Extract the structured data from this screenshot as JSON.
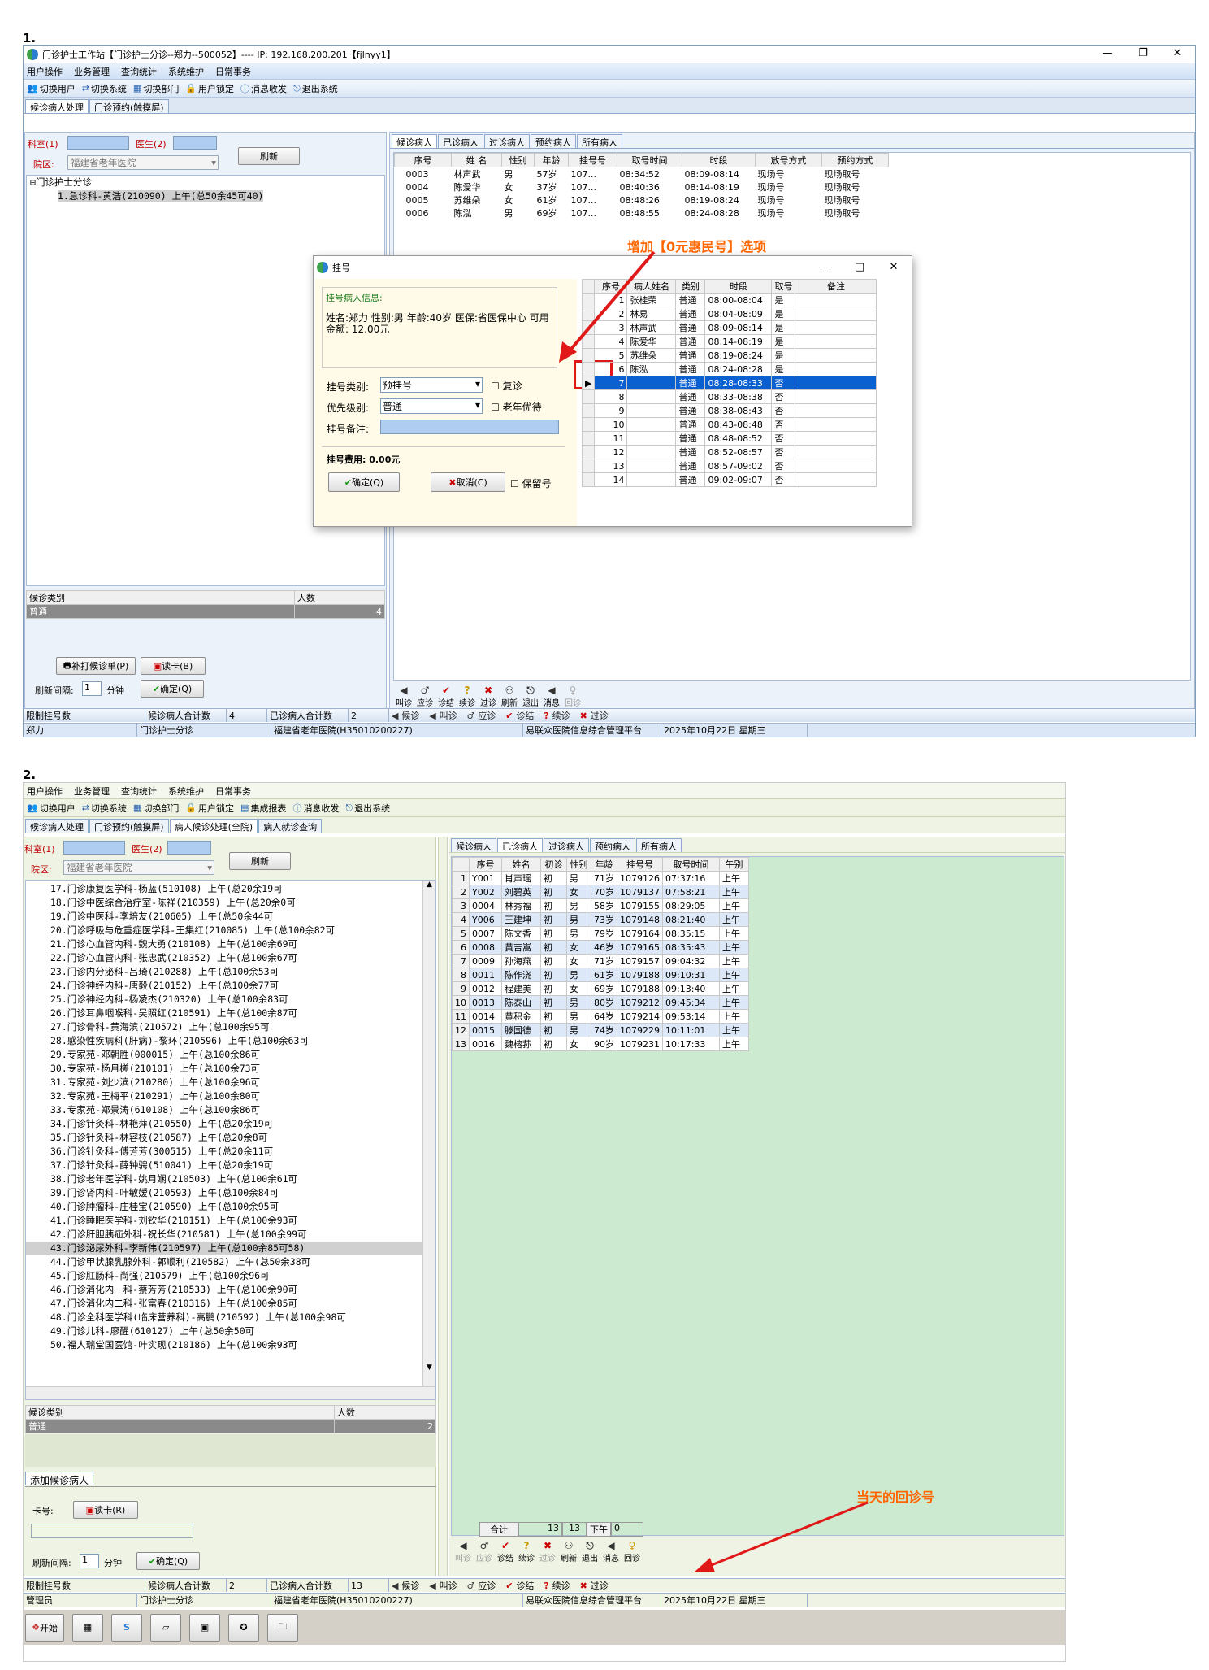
{
  "s1": {
    "num": "1.",
    "title": "门诊护士工作站【门诊护士分诊--郑力--500052】---- IP: 192.168.200.201【fjlnyy1】",
    "win_min": "—",
    "win_max": "❐",
    "win_close": "✕",
    "menu": [
      "用户操作",
      "业务管理",
      "查询统计",
      "系统维护",
      "日常事务"
    ],
    "toolbar": [
      "切换用户",
      "切换系统",
      "切换部门",
      "用户锁定",
      "消息收发",
      "退出系统"
    ],
    "tabs": [
      "候诊病人处理",
      "门诊预约(触摸屏)"
    ],
    "dept_label": "科室(1)",
    "doctor_label": "医生(2)",
    "campus_label": "院区:",
    "campus_value": "福建省老年医院",
    "refresh": "刷新",
    "tree_root": "门诊护士分诊",
    "tree_child": "1.急诊科-黄浩(210090)  上午(总50余45可40)",
    "wait_type_hdr": "候诊类别",
    "count_hdr": "人数",
    "wait_row": {
      "type": "普通",
      "count": "4"
    },
    "reprint": "补打候诊单(P)",
    "readcard": "读卡(B)",
    "interval_label": "刷新间隔:",
    "interval_val": "1",
    "interval_unit": "分钟",
    "confirm": "确定(Q)",
    "rtabs": [
      "候诊病人",
      "已诊病人",
      "过诊病人",
      "预约病人",
      "所有病人"
    ],
    "cols": [
      "序号",
      "姓 名",
      "性别",
      "年龄",
      "挂号号",
      "取号时间",
      "时段",
      "放号方式",
      "预约方式"
    ],
    "rows": [
      [
        "0003",
        "林声武",
        "男",
        "57岁",
        "107...",
        "08:34:52",
        "08:09-08:14",
        "现场号",
        "现场取号"
      ],
      [
        "0004",
        "陈爱华",
        "女",
        "37岁",
        "107...",
        "08:40:36",
        "08:14-08:19",
        "现场号",
        "现场取号"
      ],
      [
        "0005",
        "苏维朵",
        "女",
        "61岁",
        "107...",
        "08:48:26",
        "08:19-08:24",
        "现场号",
        "现场取号"
      ],
      [
        "0006",
        "陈泓",
        "男",
        "69岁",
        "107...",
        "08:48:55",
        "08:24-08:28",
        "现场号",
        "现场取号"
      ]
    ],
    "icons": [
      "叫诊",
      "应诊",
      "诊结",
      "续诊",
      "过诊",
      "刷新",
      "退出",
      "消息",
      "回诊"
    ],
    "status_icons": [
      "候诊",
      "叫诊",
      "应诊",
      "诊结",
      "续诊",
      "过诊"
    ],
    "status": [
      "限制挂号数",
      "候诊病人合计数",
      "4",
      "已诊病人合计数",
      "2"
    ],
    "footer": [
      "郑力",
      "门诊护士分诊",
      "福建省老年医院(H35010200227)",
      "易联众医院信息综合管理平台",
      "2025年10月22日 星期三"
    ],
    "annotation": "增加【0元惠民号】选项",
    "dialog": {
      "title": "挂号",
      "info_hdr": "挂号病人信息:",
      "info": "姓名:郑力 性别:男 年龄:40岁 医保:省医保中心 可用金额: 12.00元",
      "type_label": "挂号类别:",
      "type_val": "预挂号",
      "revisit": "复诊",
      "priority_label": "优先级别:",
      "priority_val": "普通",
      "elder": "老年优待",
      "remark_label": "挂号备注:",
      "fee": "挂号费用: 0.00元",
      "ok": "确定(Q)",
      "cancel": "取消(C)",
      "keep": "保留号",
      "cols": [
        "序号",
        "病人姓名",
        "类别",
        "时段",
        "取号",
        "备注"
      ],
      "rows": [
        [
          "1",
          "张桂荣",
          "普通",
          "08:00-08:04",
          "是"
        ],
        [
          "2",
          "林易",
          "普通",
          "08:04-08:09",
          "是"
        ],
        [
          "3",
          "林声武",
          "普通",
          "08:09-08:14",
          "是"
        ],
        [
          "4",
          "陈爱华",
          "普通",
          "08:14-08:19",
          "是"
        ],
        [
          "5",
          "苏维朵",
          "普通",
          "08:19-08:24",
          "是"
        ],
        [
          "6",
          "陈泓",
          "普通",
          "08:24-08:28",
          "是"
        ],
        [
          "7",
          "",
          "普通",
          "08:28-08:33",
          "否"
        ],
        [
          "8",
          "",
          "普通",
          "08:33-08:38",
          "否"
        ],
        [
          "9",
          "",
          "普通",
          "08:38-08:43",
          "否"
        ],
        [
          "10",
          "",
          "普通",
          "08:43-08:48",
          "否"
        ],
        [
          "11",
          "",
          "普通",
          "08:48-08:52",
          "否"
        ],
        [
          "12",
          "",
          "普通",
          "08:52-08:57",
          "否"
        ],
        [
          "13",
          "",
          "普通",
          "08:57-09:02",
          "否"
        ],
        [
          "14",
          "",
          "普通",
          "09:02-09:07",
          "否"
        ]
      ]
    }
  },
  "s2": {
    "num": "2.",
    "menu": [
      "用户操作",
      "业务管理",
      "查询统计",
      "系统维护",
      "日常事务"
    ],
    "toolbar": [
      "切换用户",
      "切换系统",
      "切换部门",
      "用户锁定",
      "集成报表",
      "消息收发",
      "退出系统"
    ],
    "tabs": [
      "候诊病人处理",
      "门诊预约(触摸屏)",
      "病人候诊处理(全院)",
      "病人就诊查询"
    ],
    "dept_label": "科室(1)",
    "doctor_label": "医生(2)",
    "campus_label": "院区:",
    "campus_value": "福建省老年医院",
    "refresh": "刷新",
    "tree": [
      "17.门诊康复医学科-杨蓝(510108) 上午(总20余19可",
      "18.门诊中医综合治疗室-陈祥(210359) 上午(总20余0可",
      "19.门诊中医科-李培友(210605) 上午(总50余44可",
      "20.门诊呼吸与危重症医学科-王集红(210085) 上午(总100余82可",
      "21.门诊心血管内科-魏大勇(210108) 上午(总100余69可",
      "22.门诊心血管内科-张忠武(210352) 上午(总100余67可",
      "23.门诊内分泌科-吕琦(210288) 上午(总100余53可",
      "24.门诊神经内科-唐毅(210152) 上午(总100余77可",
      "25.门诊神经内科-杨凌杰(210320) 上午(总100余83可",
      "26.门诊耳鼻咽喉科-吴照红(210591) 上午(总100余87可",
      "27.门诊骨科-黄海滨(210572) 上午(总100余95可",
      "28.感染性疾病科(肝病)-黎环(210596) 上午(总100余63可",
      "29.专家苑-邓朝胜(000015) 上午(总100余86可",
      "30.专家苑-杨月槎(210101) 上午(总100余73可",
      "31.专家苑-刘少滨(210280) 上午(总100余96可",
      "32.专家苑-王梅平(210291) 上午(总100余80可",
      "33.专家苑-郑景涛(610108) 上午(总100余86可",
      "34.门诊针灸科-林艳萍(210550) 上午(总20余19可",
      "35.门诊针灸科-林容枝(210587) 上午(总20余8可",
      "36.门诊针灸科-傅芳芳(300515) 上午(总20余11可",
      "37.门诊针灸科-薛钟骋(510041) 上午(总20余19可",
      "38.门诊老年医学科-姚月娴(210503) 上午(总100余61可",
      "39.门诊肾内科-叶敏嫒(210593) 上午(总100余84可",
      "40.门诊肿瘤科-庄桂宝(210590) 上午(总100余95可",
      "41.门诊睡眠医学科-刘钦华(210151) 上午(总100余93可",
      "42.门诊肝胆胰疝外科-祝长华(210581) 上午(总100余99可",
      "43.门诊泌尿外科-李新伟(210597) 上午(总100余85可58)",
      "44.门诊甲状腺乳腺外科-郭顺利(210582) 上午(总50余38可",
      "45.门诊肛肠科-尚强(210579) 上午(总100余96可",
      "46.门诊消化内一科-蔡芳芳(210533) 上午(总100余90可",
      "47.门诊消化内二科-张富春(210316) 上午(总100余85可",
      "48.门诊全科医学科(临床营养科)-高鹏(210592) 上午(总100余98可",
      "49.门诊儿科-廖醒(610127) 上午(总50余50可",
      "50.福人瑞堂国医馆-叶实现(210186) 上午(总100余93可"
    ],
    "wait_type_hdr": "候诊类别",
    "count_hdr": "人数",
    "wait_row": {
      "type": "普通",
      "count": "2"
    },
    "add_tab": "添加候诊病人",
    "card_label": "卡号:",
    "readcard": "读卡(R)",
    "interval_label": "刷新间隔:",
    "interval_val": "1",
    "interval_unit": "分钟",
    "confirm": "确定(Q)",
    "rtabs": [
      "候诊病人",
      "已诊病人",
      "过诊病人",
      "预约病人",
      "所有病人"
    ],
    "cols": [
      "",
      "序号",
      "姓名",
      "初诊",
      "性别",
      "年龄",
      "挂号号",
      "取号时间",
      "午别"
    ],
    "rows": [
      [
        "1",
        "Y001",
        "肖声瑶",
        "初",
        "男",
        "71岁",
        "1079126",
        "07:37:16",
        "上午"
      ],
      [
        "2",
        "Y002",
        "刘碧英",
        "初",
        "女",
        "70岁",
        "1079137",
        "07:58:21",
        "上午"
      ],
      [
        "3",
        "0004",
        "林秀福",
        "初",
        "男",
        "58岁",
        "1079155",
        "08:29:05",
        "上午"
      ],
      [
        "4",
        "Y006",
        "王建坤",
        "初",
        "男",
        "73岁",
        "1079148",
        "08:21:40",
        "上午"
      ],
      [
        "5",
        "0007",
        "陈文香",
        "初",
        "男",
        "79岁",
        "1079164",
        "08:35:15",
        "上午"
      ],
      [
        "6",
        "0008",
        "黄吉嵩",
        "初",
        "女",
        "46岁",
        "1079165",
        "08:35:43",
        "上午"
      ],
      [
        "7",
        "0009",
        "孙海燕",
        "初",
        "女",
        "71岁",
        "1079157",
        "09:04:32",
        "上午"
      ],
      [
        "8",
        "0011",
        "陈作浇",
        "初",
        "男",
        "61岁",
        "1079188",
        "09:10:31",
        "上午"
      ],
      [
        "9",
        "0012",
        "程建美",
        "初",
        "女",
        "69岁",
        "1079188",
        "09:13:40",
        "上午"
      ],
      [
        "10",
        "0013",
        "陈泰山",
        "初",
        "男",
        "80岁",
        "1079212",
        "09:45:34",
        "上午"
      ],
      [
        "11",
        "0014",
        "黄积金",
        "初",
        "男",
        "64岁",
        "1079214",
        "09:53:14",
        "上午"
      ],
      [
        "12",
        "0015",
        "滕国德",
        "初",
        "男",
        "74岁",
        "1079229",
        "10:11:01",
        "上午"
      ],
      [
        "13",
        "0016",
        "魏榕荪",
        "初",
        "女",
        "90岁",
        "1079231",
        "10:17:33",
        "上午"
      ]
    ],
    "total_label": "合计",
    "total_a": "13",
    "total_b": "13",
    "pm_label": "下午",
    "pm_val": "0",
    "icons": [
      "叫诊",
      "应诊",
      "诊结",
      "续诊",
      "过诊",
      "刷新",
      "退出",
      "消息",
      "回诊"
    ],
    "status_icons": [
      "候诊",
      "叫诊",
      "应诊",
      "诊结",
      "续诊",
      "过诊"
    ],
    "status": [
      "限制挂号数",
      "候诊病人合计数",
      "2",
      "已诊病人合计数",
      "13"
    ],
    "footer": [
      "管理员",
      "门诊护士分诊",
      "福建省老年医院(H35010200227)",
      "易联众医院信息综合管理平台",
      "2025年10月22日 星期三"
    ],
    "taskbar_start": "开始",
    "annotation": "当天的回诊号"
  }
}
